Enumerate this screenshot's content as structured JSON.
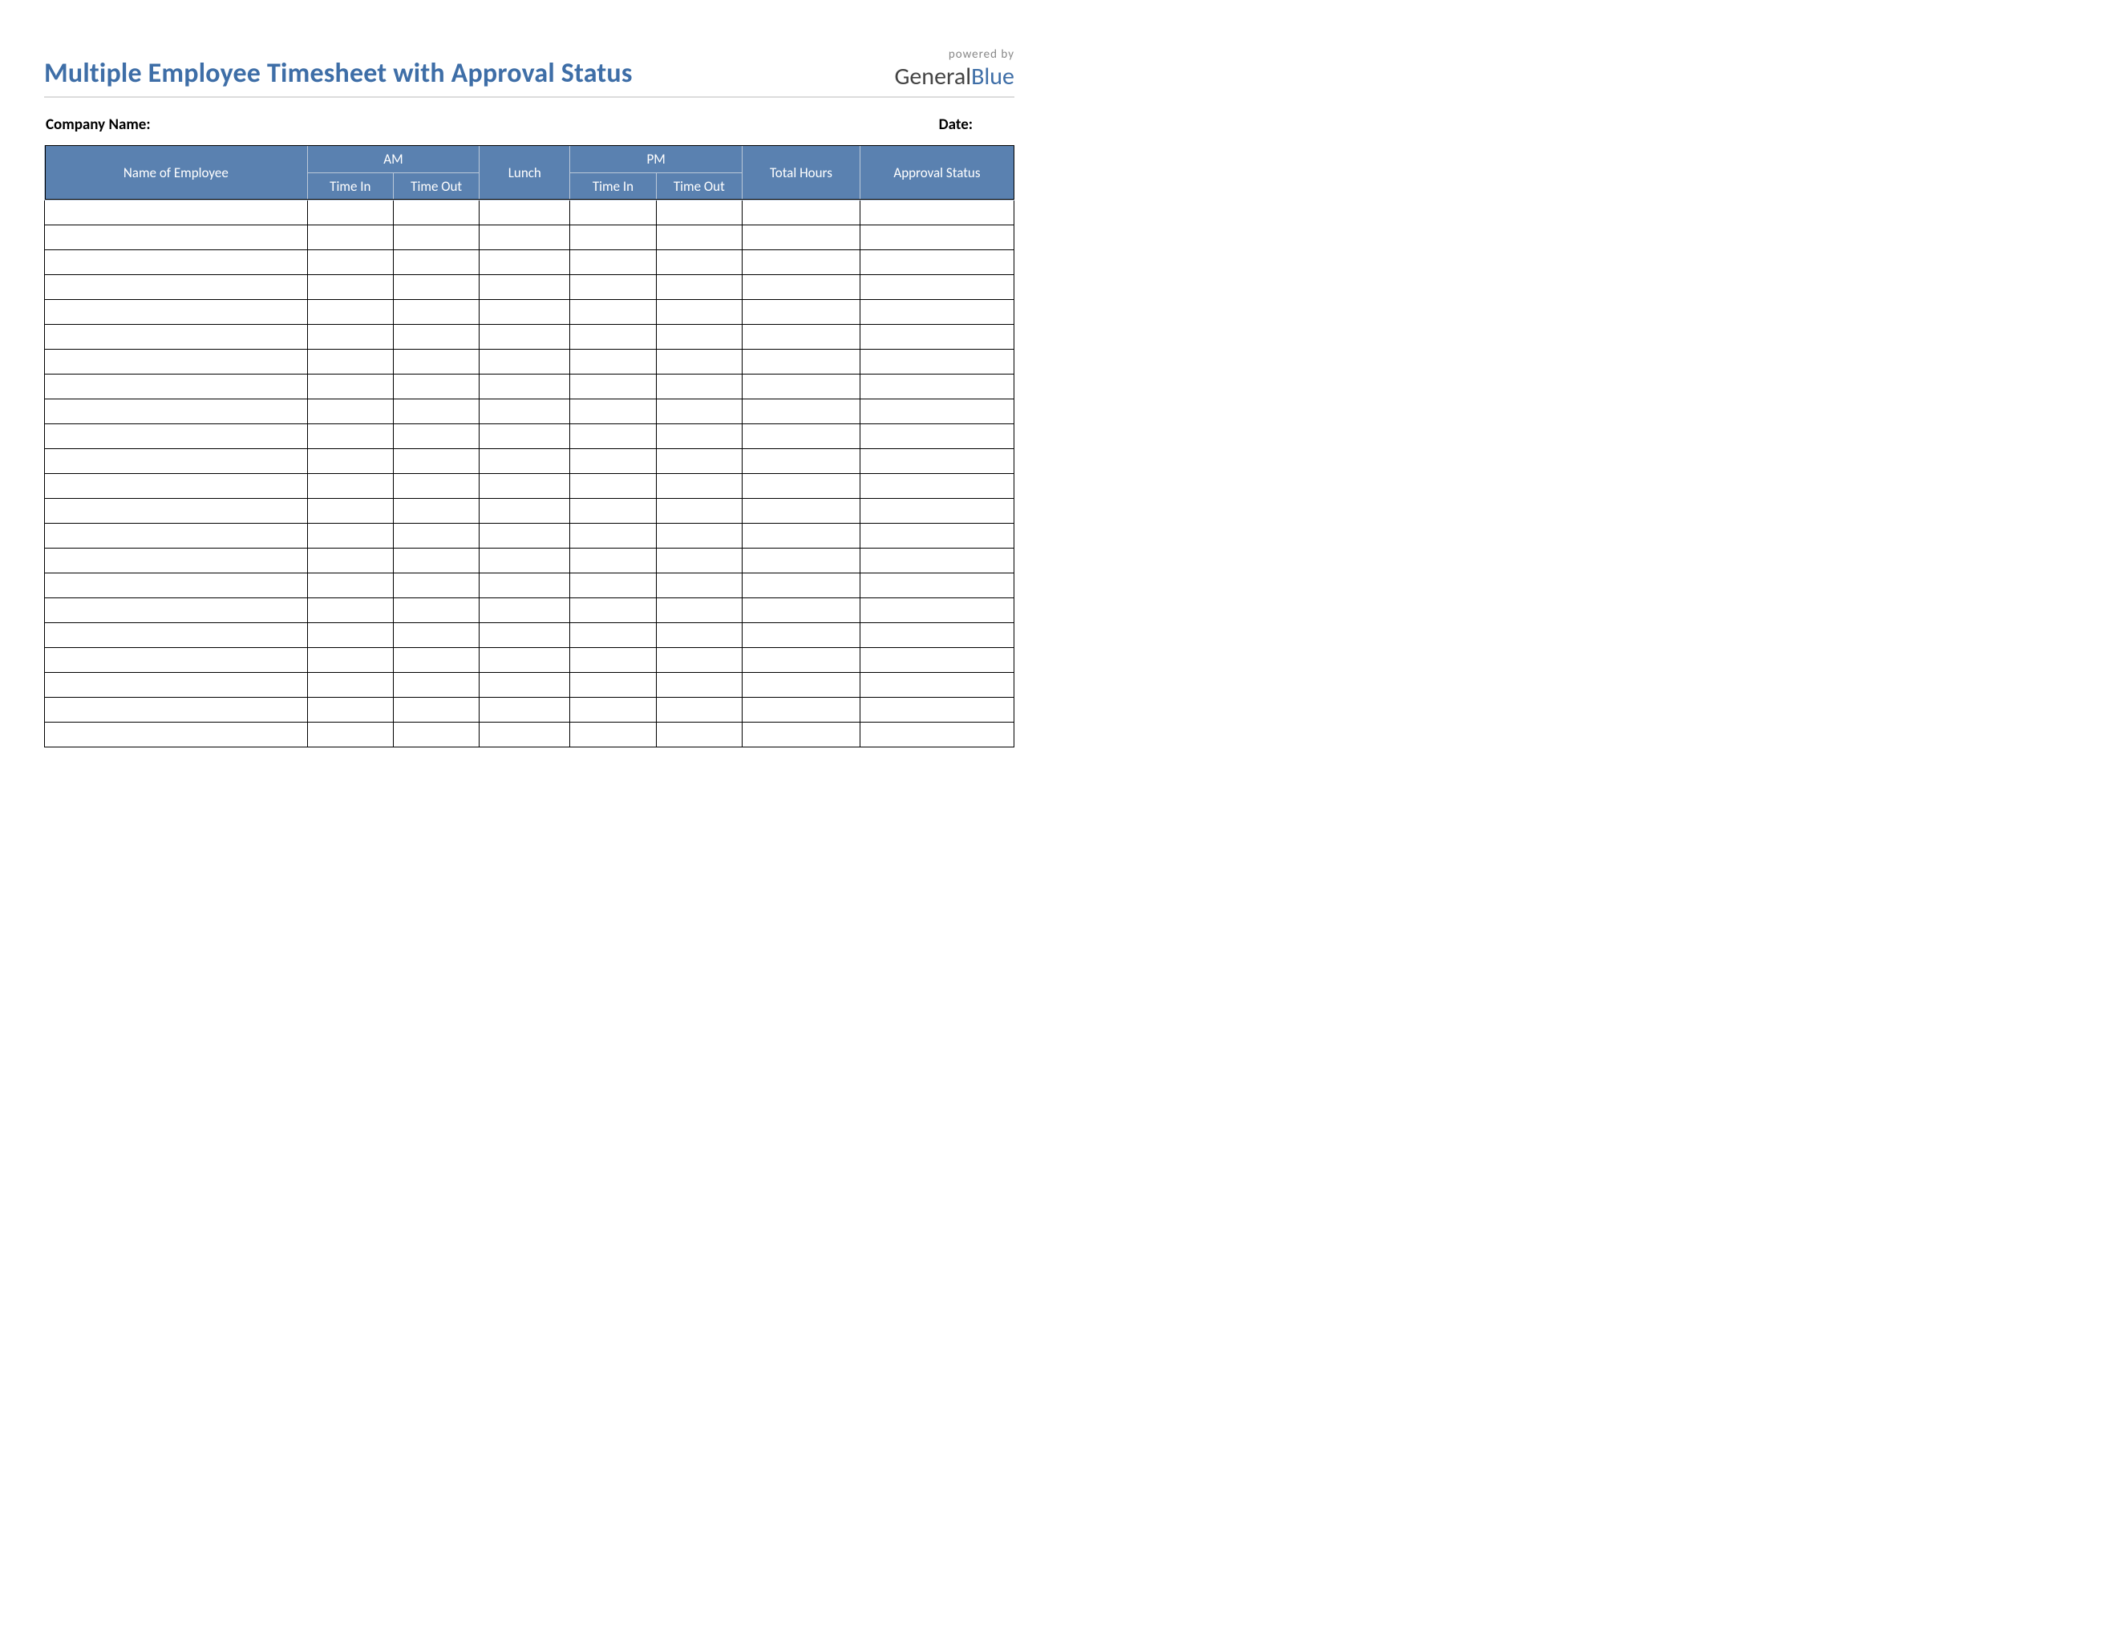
{
  "header": {
    "title": "Multiple Employee Timesheet with Approval Status",
    "powered_by": "powered by",
    "brand_a": "General",
    "brand_b": "Blue"
  },
  "meta": {
    "company_label": "Company Name:",
    "company_value": "",
    "date_label": "Date:",
    "date_value": ""
  },
  "columns": {
    "name": "Name of Employee",
    "am": "AM",
    "pm": "PM",
    "time_in": "Time In",
    "time_out": "Time Out",
    "lunch": "Lunch",
    "total": "Total Hours",
    "approval": "Approval Status"
  },
  "row_count": 22
}
